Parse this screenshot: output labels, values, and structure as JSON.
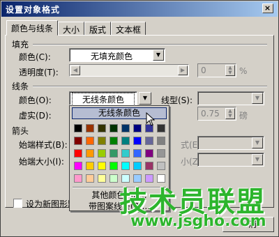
{
  "dialog": {
    "title": "设置对象格式",
    "close_label": "×"
  },
  "tabs": [
    {
      "label": "颜色与线条",
      "active": true
    },
    {
      "label": "大小",
      "active": false
    },
    {
      "label": "版式",
      "active": false
    },
    {
      "label": "文本框",
      "active": false
    }
  ],
  "fill": {
    "section": "填充",
    "color_label": "颜色(C):",
    "color_value": "无填充颜色",
    "transparency_label": "透明度(T):",
    "transparency_value": "0",
    "transparency_unit": "%"
  },
  "line": {
    "section": "线条",
    "color_label": "颜色(O):",
    "color_value": "无线条颜色",
    "style_label": "线型(S):",
    "dash_label": "虚实(D):",
    "weight_value": "0.75",
    "weight_unit": "磅"
  },
  "arrows": {
    "section": "箭头",
    "begin_style_label": "始端样式(B):",
    "begin_size_label": "始端大小(I):",
    "end_style_label": "式(E):",
    "end_size_label": "小(Z):"
  },
  "default_checkbox_label": "设为新图形默",
  "cancel_label": "消",
  "color_popup": {
    "no_color": "无线条颜色",
    "more_colors": "其他颜色(M)...",
    "patterned_lines": "带图案线条(P)...",
    "swatches": [
      [
        "#000000",
        "#993300",
        "#333300",
        "#003300",
        "#003366",
        "#000080",
        "#333399",
        "#333333"
      ],
      [
        "#800000",
        "#ff6600",
        "#808000",
        "#008000",
        "#008080",
        "#0000ff",
        "#666699",
        "#808080"
      ],
      [
        "#ff0000",
        "#ff9900",
        "#99cc00",
        "#339966",
        "#33cccc",
        "#3366ff",
        "#800080",
        "#969696"
      ],
      [
        "#ff00ff",
        "#ffcc00",
        "#ffff00",
        "#00ff00",
        "#00ffff",
        "#00ccff",
        "#993366",
        "#c0c0c0"
      ],
      [
        "#ff99cc",
        "#ffcc99",
        "#ffff99",
        "#ccffcc",
        "#ccffff",
        "#99ccff",
        "#cc99ff",
        "#ffffff"
      ]
    ]
  },
  "watermark": {
    "text": "技术员联盟",
    "url": "www.jsgho.com"
  }
}
